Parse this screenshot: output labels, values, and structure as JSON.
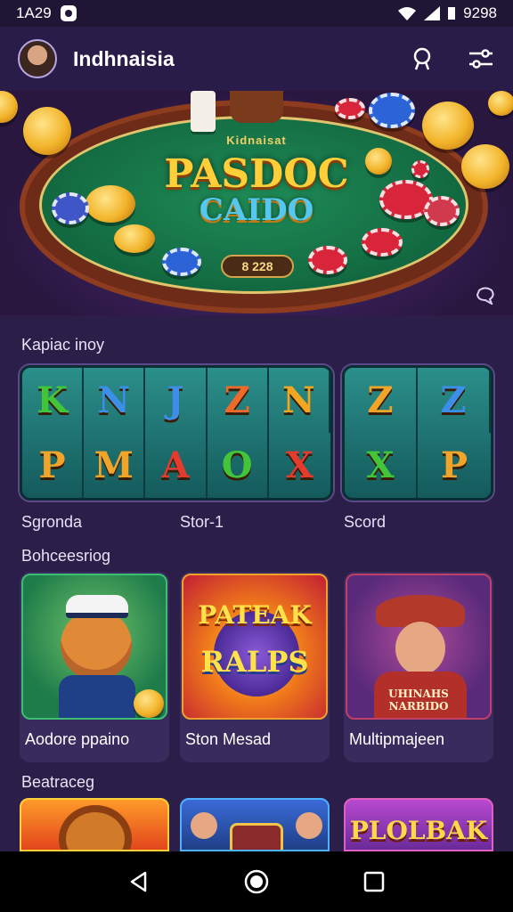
{
  "status_bar": {
    "time": "1A29",
    "indicators": "9298"
  },
  "header": {
    "title": "Indhnaisia",
    "search_icon": "search-icon",
    "filter_icon": "filter-icon"
  },
  "hero": {
    "kicker": "Kidnaisat",
    "title": "PASDOC",
    "subtitle": "CAIDO",
    "badge": "8 228"
  },
  "sections": [
    {
      "title": "Kapiac inoy",
      "slots": [
        {
          "label": "Sgronda",
          "rows": [
            [
              "K",
              "N",
              "J",
              "Z",
              "N"
            ],
            [
              "P",
              "M",
              "A",
              "O",
              "X"
            ]
          ]
        },
        {
          "label": "Stor-1"
        },
        {
          "label": "Scord",
          "rows": [
            [
              "Z",
              "Z"
            ],
            [
              "X",
              "P"
            ]
          ]
        }
      ]
    },
    {
      "title": "Bohceesriog",
      "games": [
        {
          "name": "Aodore ppaino"
        },
        {
          "name": "Ston Mesad",
          "art_line1": "PATEAK",
          "art_line2": "RALPS"
        },
        {
          "name": "Multipmajeen",
          "art_line1": "UHINAHS",
          "art_line2": "NARBIDO"
        }
      ]
    },
    {
      "title": "Beatraceg",
      "games": [
        {
          "art": "lion"
        },
        {
          "art": "casino"
        },
        {
          "art_line1": "PLOLBAK"
        }
      ]
    }
  ],
  "colors": {
    "background": "#2b1f4a",
    "header": "#2a1c49",
    "felt": "#126840",
    "gold": "#ffcf3a"
  }
}
